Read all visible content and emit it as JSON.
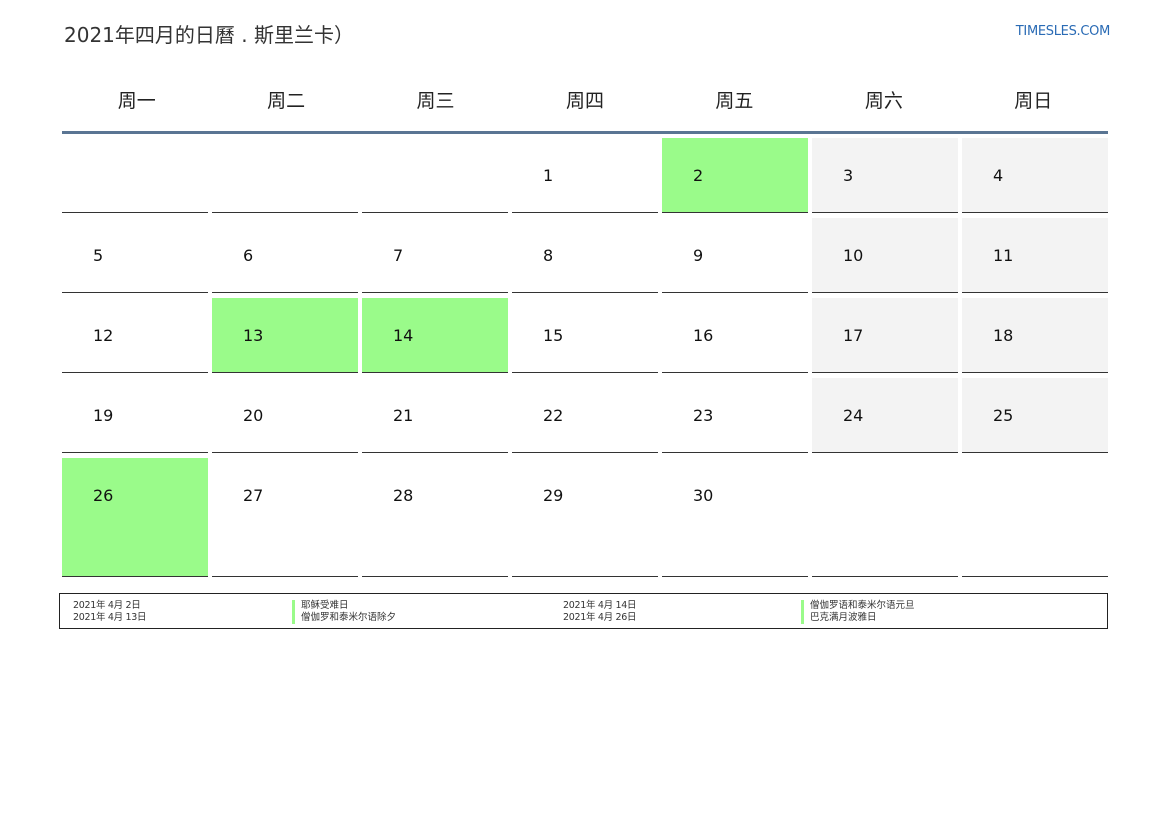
{
  "header": {
    "title": "2021年四月的日曆 . 斯里兰卡）",
    "site": "TIMESLES.COM"
  },
  "weekdays": [
    "周一",
    "周二",
    "周三",
    "周四",
    "周五",
    "周六",
    "周日"
  ],
  "weeks": [
    [
      "",
      "",
      "",
      "1",
      "2",
      "3",
      "4"
    ],
    [
      "5",
      "6",
      "7",
      "8",
      "9",
      "10",
      "11"
    ],
    [
      "12",
      "13",
      "14",
      "15",
      "16",
      "17",
      "18"
    ],
    [
      "19",
      "20",
      "21",
      "22",
      "23",
      "24",
      "25"
    ],
    [
      "26",
      "27",
      "28",
      "29",
      "30",
      "",
      ""
    ]
  ],
  "highlighted_days": [
    "2",
    "13",
    "14",
    "26"
  ],
  "colors": {
    "holiday": "#9afb8a",
    "weekend": "#f3f3f3",
    "header_rule": "#5a7593",
    "site_link": "#2a6bb5"
  },
  "holidays": [
    {
      "date": "2021年 4月 2日",
      "name": "耶稣受难日"
    },
    {
      "date": "2021年 4月 13日",
      "name": "僧伽罗和泰米尔语除夕"
    },
    {
      "date": "2021年 4月 14日",
      "name": "僧伽罗语和泰米尔语元旦"
    },
    {
      "date": "2021年 4月 26日",
      "name": "巴克满月波雅日"
    }
  ]
}
